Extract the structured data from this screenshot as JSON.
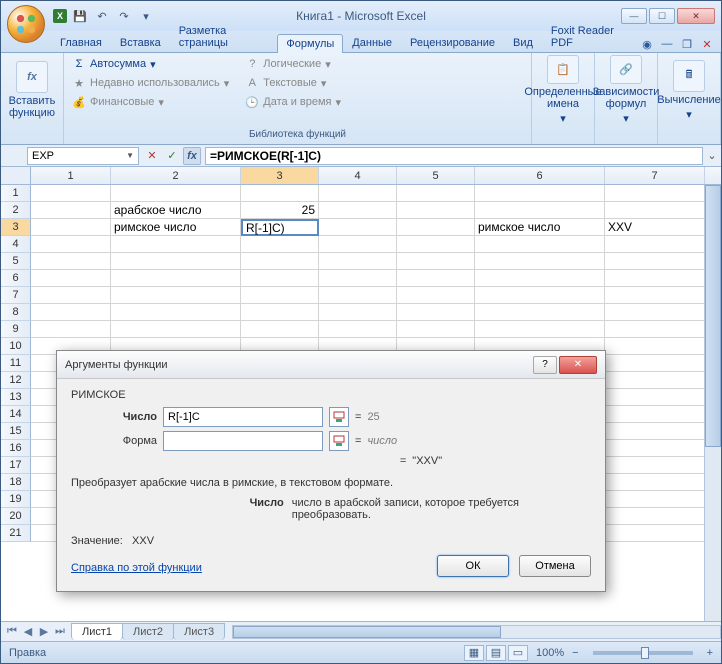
{
  "window": {
    "title": "Книга1 - Microsoft Excel"
  },
  "tabs": {
    "t0": "Главная",
    "t1": "Вставка",
    "t2": "Разметка страницы",
    "t3": "Формулы",
    "t4": "Данные",
    "t5": "Рецензирование",
    "t6": "Вид",
    "t7": "Foxit Reader PDF"
  },
  "ribbon": {
    "insert_fn": "Вставить\nфункцию",
    "autosum": "Автосумма",
    "recent": "Недавно использовались",
    "financial": "Финансовые",
    "logical": "Логические",
    "text": "Текстовые",
    "datetime": "Дата и время",
    "lib_label": "Библиотека функций",
    "defined_names": "Определенные\nимена",
    "formula_deps": "Зависимости\nформул",
    "calculation": "Вычисление"
  },
  "fbar": {
    "namebox": "EXP",
    "formula": "=РИМСКОЕ(R[-1]C)"
  },
  "cols": {
    "c1": "1",
    "c2": "2",
    "c3": "3",
    "c4": "4",
    "c5": "5",
    "c6": "6",
    "c7": "7"
  },
  "rows": {
    "r1": "1",
    "r2": "2",
    "r3": "3",
    "r4": "4",
    "r5": "5",
    "r6": "6",
    "r7": "7",
    "r8": "8",
    "r9": "9",
    "r10": "10",
    "r11": "11",
    "r12": "12",
    "r13": "13",
    "r14": "14",
    "r15": "15",
    "r16": "16",
    "r17": "17",
    "r18": "18",
    "r19": "19",
    "r20": "20",
    "r21": "21"
  },
  "cells": {
    "b2": "арабское число",
    "c2": "25",
    "b3": "римское число",
    "c3": "R[-1]C)",
    "f3": "римское число",
    "g3": "XXV"
  },
  "dialog": {
    "title": "Аргументы функции",
    "funcname": "РИМСКОЕ",
    "arg1_label": "Число",
    "arg1_value": "R[-1]C",
    "arg1_result": "25",
    "arg2_label": "Форма",
    "arg2_value": "",
    "arg2_result": "число",
    "overall_result": "\"XXV\"",
    "desc": "Преобразует арабские числа в римские, в текстовом формате.",
    "argdesc_label": "Число",
    "argdesc_text": "число в арабской записи, которое требуется преобразовать.",
    "value_label": "Значение:",
    "value_result": "XXV",
    "help": "Справка по этой функции",
    "ok": "ОК",
    "cancel": "Отмена",
    "eq": "="
  },
  "sheets": {
    "s1": "Лист1",
    "s2": "Лист2",
    "s3": "Лист3"
  },
  "status": {
    "mode": "Правка",
    "zoom": "100%"
  }
}
